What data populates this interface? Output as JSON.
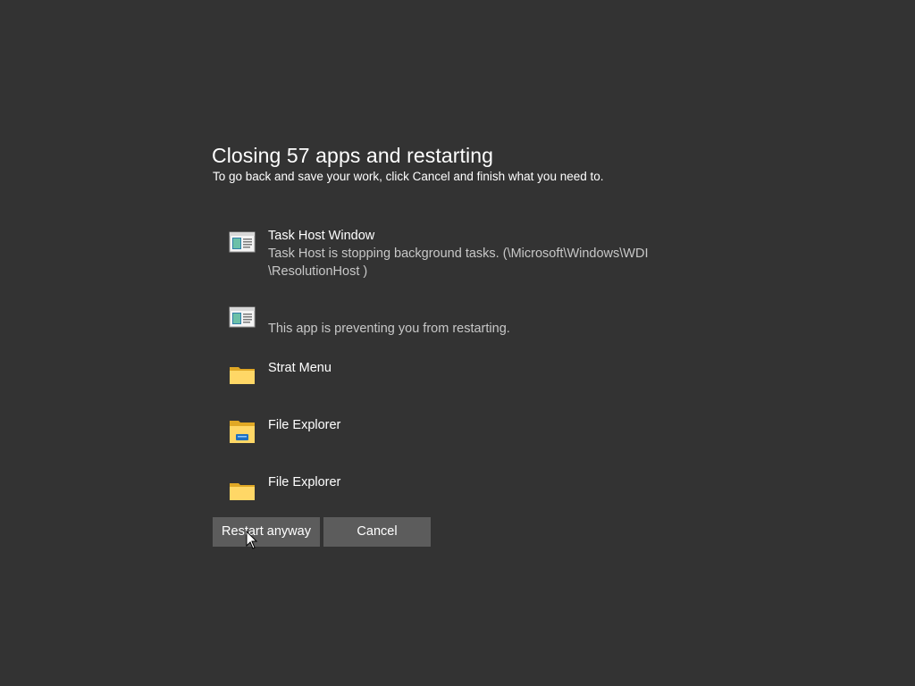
{
  "header": {
    "title": "Closing 57 apps and restarting",
    "subtitle": "To go back and save your work, click Cancel and finish what you need to."
  },
  "apps": [
    {
      "icon": "task-host-window-icon",
      "name": "Task Host Window",
      "description_line1": "Task Host is stopping background tasks. (\\Microsoft\\Windows\\WDI",
      "description_line2": "\\ResolutionHost )"
    },
    {
      "icon": "task-host-window-icon",
      "name": "",
      "description_line1": "This app is preventing you from restarting."
    },
    {
      "icon": "folder-icon",
      "name": "Strat Menu"
    },
    {
      "icon": "file-explorer-icon",
      "name": "File Explorer"
    },
    {
      "icon": "folder-icon",
      "name": "File Explorer"
    }
  ],
  "buttons": {
    "restart_label": "Restart anyway",
    "cancel_label": "Cancel"
  },
  "colors": {
    "background": "#333333",
    "button": "#5c5c5c",
    "secondary_text": "#c8c8c8"
  }
}
